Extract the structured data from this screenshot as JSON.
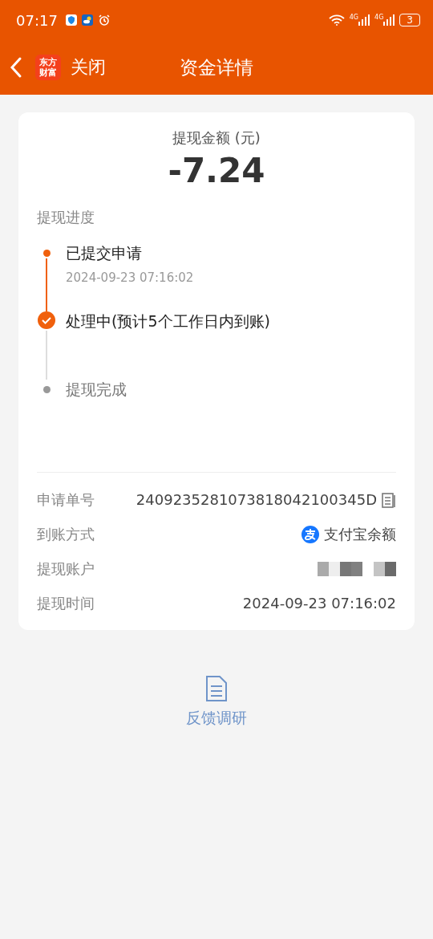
{
  "status_bar": {
    "time": "07:17",
    "battery": "3",
    "network_labels": [
      "4G",
      "4G"
    ]
  },
  "nav": {
    "logo_lines": [
      "东方",
      "财富"
    ],
    "close": "关闭",
    "title": "资金详情"
  },
  "amount": {
    "label": "提现金额 (元)",
    "value": "-7.24"
  },
  "progress": {
    "title": "提现进度",
    "steps": [
      {
        "kind": "done",
        "label": "已提交申请",
        "time": "2024-09-23 07:16:02"
      },
      {
        "kind": "current",
        "label": "处理中(预计5个工作日内到账)"
      },
      {
        "kind": "pending",
        "label": "提现完成"
      }
    ]
  },
  "details": [
    {
      "kind": "copy",
      "label": "申请单号",
      "value": "2409235281073818042100345D"
    },
    {
      "kind": "alipay",
      "label": "到账方式",
      "value": "支付宝余额"
    },
    {
      "kind": "redacted",
      "label": "提现账户"
    },
    {
      "kind": "text",
      "label": "提现时间",
      "value": "2024-09-23 07:16:02"
    }
  ],
  "feedback": {
    "label": "反馈调研"
  }
}
